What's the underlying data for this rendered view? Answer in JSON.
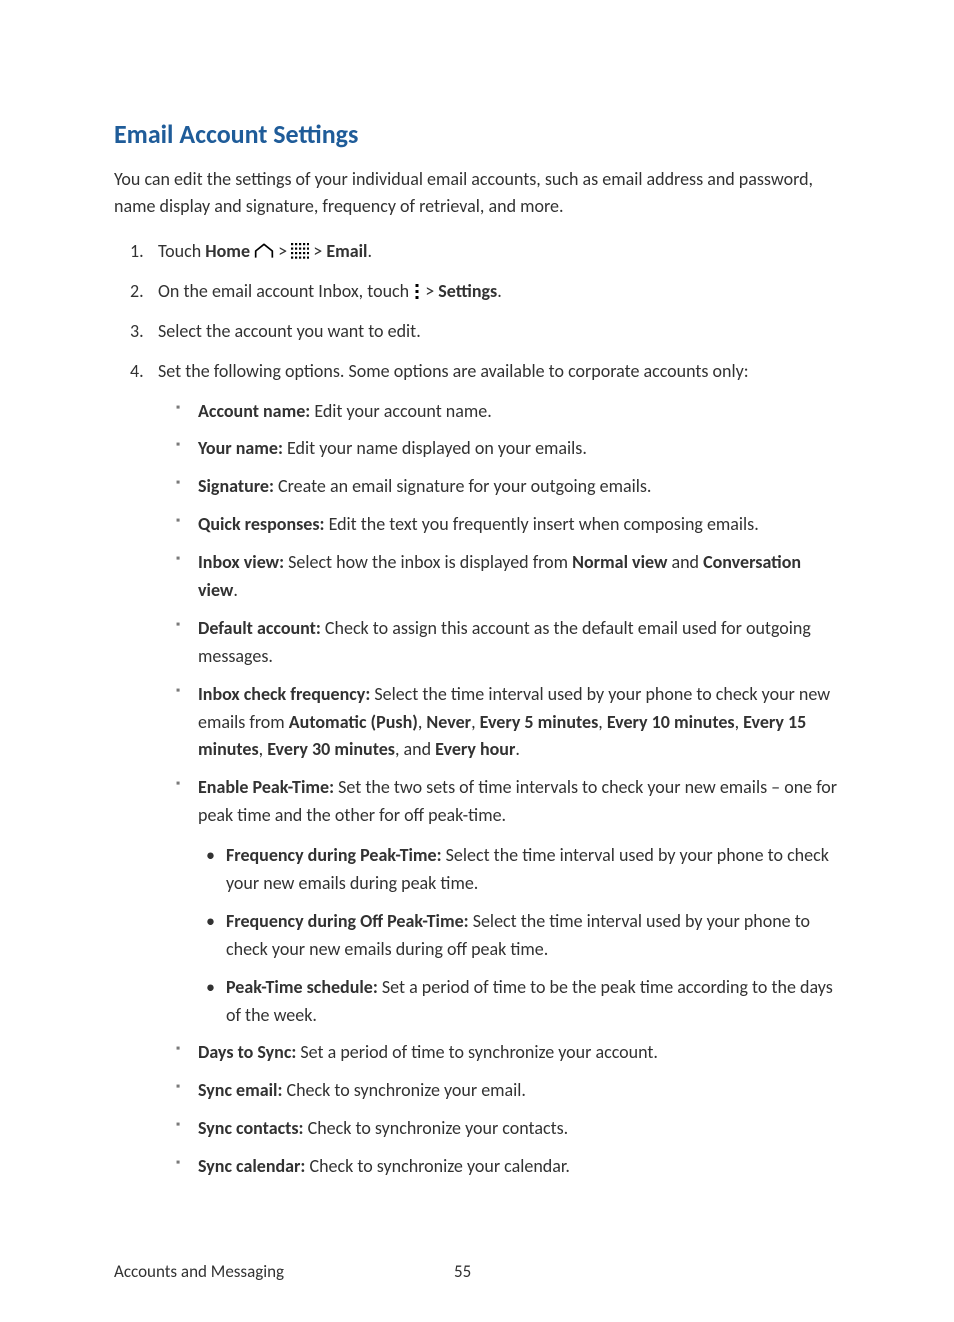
{
  "title": "Email Account Settings",
  "intro": "You can edit the settings of your individual email accounts, such as email address and password, name display and signature, frequency of retrieval, and more.",
  "step1": {
    "pre": "Touch ",
    "home": "Home",
    "gt1": " > ",
    "gt2": " > ",
    "email": "Email",
    "dot": "."
  },
  "step2": {
    "pre": "On the email account Inbox, touch ",
    "gt": " > ",
    "settings": "Settings",
    "dot": "."
  },
  "step3": "Select the account you want to edit.",
  "step4": "Set the following options. Some options are available to corporate accounts only:",
  "opts": {
    "accountName": {
      "label": "Account name:",
      "desc": " Edit your account name."
    },
    "yourName": {
      "label": "Your name:",
      "desc": " Edit your name displayed on your emails."
    },
    "signature": {
      "label": "Signature:",
      "desc": " Create an email signature for your outgoing emails."
    },
    "quick": {
      "label": "Quick responses:",
      "desc": " Edit the text you frequently insert when composing emails."
    },
    "inboxView": {
      "label": "Inbox view:",
      "desc1": " Select how the inbox is displayed from ",
      "normal": "Normal view",
      "and": " and ",
      "convo": "Conversation view",
      "dot": "."
    },
    "defaultAcct": {
      "label": "Default account:",
      "desc": " Check to assign this account as the default email used for outgoing messages."
    },
    "freq": {
      "label": "Inbox check frequency:",
      "desc1": " Select the time interval used by your phone to check your new emails from ",
      "auto": "Automatic (Push)",
      "c1": ", ",
      "never": "Never",
      "c2": ", ",
      "e5": "Every 5 minutes",
      "c3": ", ",
      "e10": "Every 10 minutes",
      "c4": ", ",
      "e15": "Every 15 minutes",
      "c5": ", ",
      "e30": "Every 30 minutes",
      "c6": ", and ",
      "ehour": "Every hour",
      "dot": "."
    },
    "peak": {
      "label": "Enable Peak-Time:",
      "desc": " Set the two sets of time intervals to check your new emails – one for peak time and the other for off peak-time.",
      "s1": {
        "label": "Frequency during Peak-Time:",
        "desc": " Select the time interval used by your phone to check your new emails during peak time."
      },
      "s2": {
        "label": "Frequency during Off Peak-Time:",
        "desc": " Select the time interval used by your phone to check your new emails during off peak time."
      },
      "s3": {
        "label": "Peak-Time schedule:",
        "desc": " Set a period of time to be the peak time according to the days of the week."
      }
    },
    "days": {
      "label": "Days to Sync:",
      "desc": " Set a period of time to synchronize your account."
    },
    "syncEmail": {
      "label": "Sync email:",
      "desc": " Check to synchronize your email."
    },
    "syncContacts": {
      "label": "Sync contacts:",
      "desc": " Check to synchronize your contacts."
    },
    "syncCalendar": {
      "label": "Sync calendar:",
      "desc": " Check to synchronize your calendar."
    }
  },
  "footer": {
    "section": "Accounts and Messaging",
    "page": "55"
  }
}
